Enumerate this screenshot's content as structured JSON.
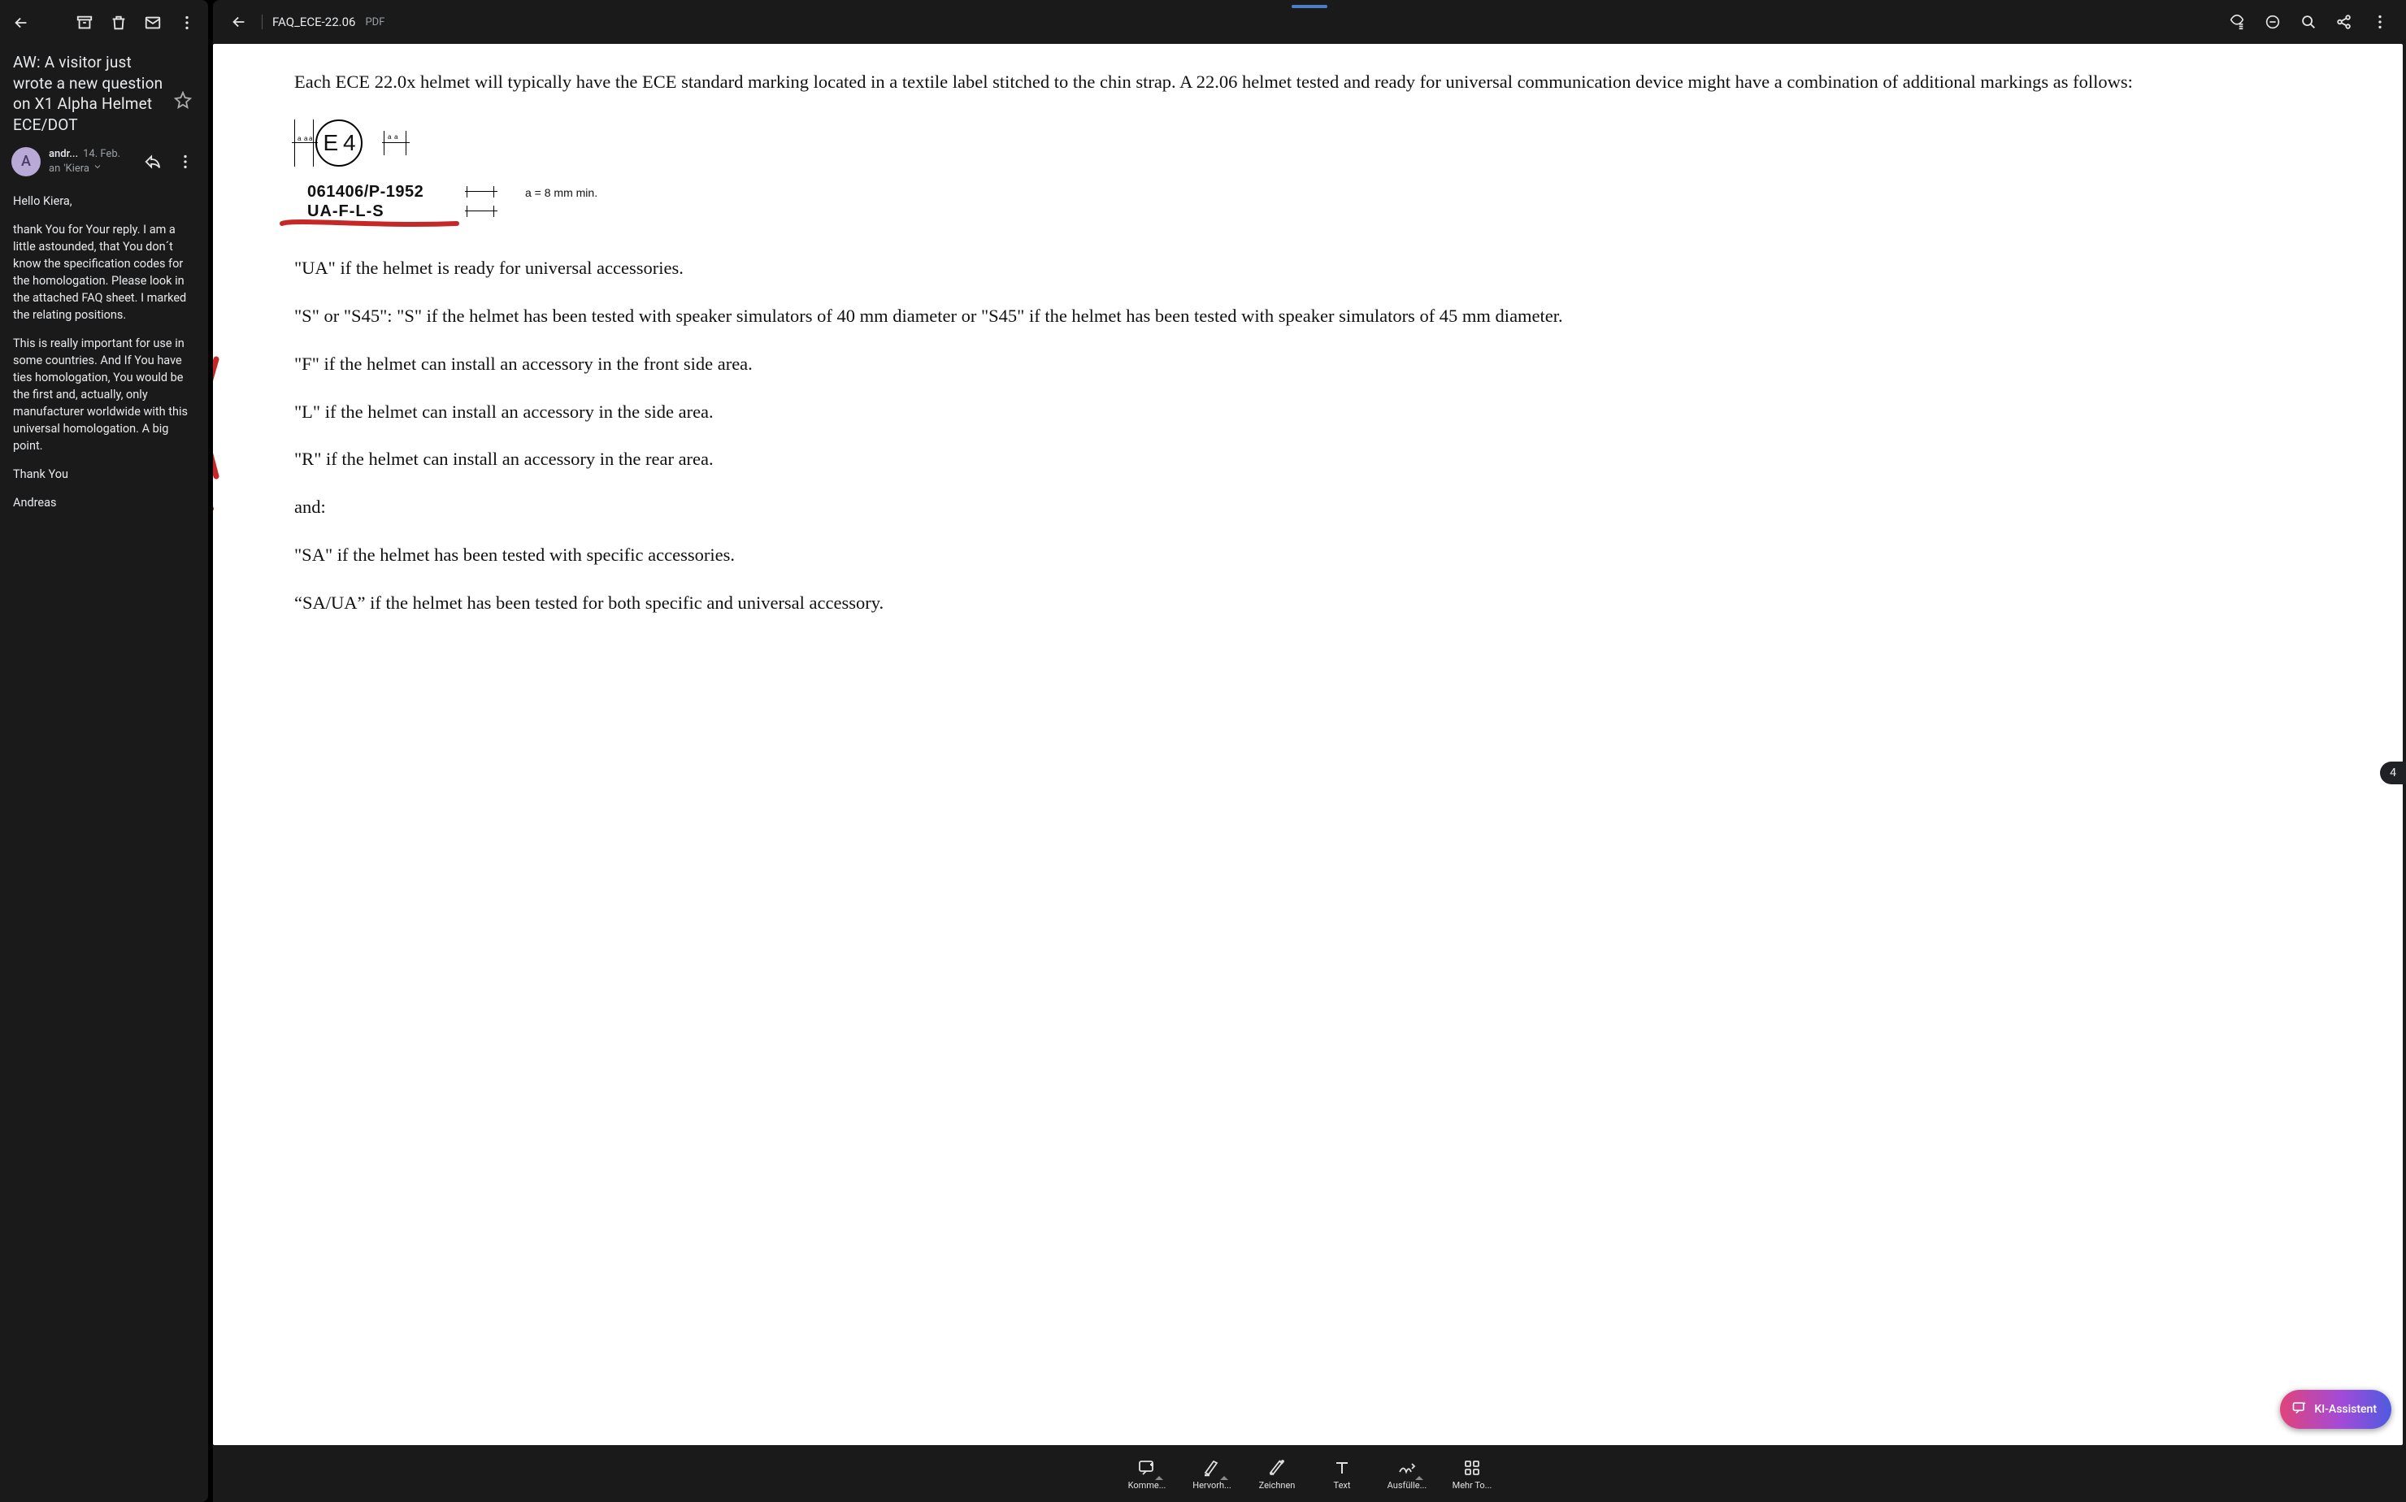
{
  "email": {
    "subject": "AW: A visitor just wrote a new question on X1 Alpha Helmet ECE/DOT",
    "sender_initial": "A",
    "sender_name": "andr...",
    "sender_date": "14. Feb.",
    "to_prefix": "an",
    "to_name": "'Kiera",
    "body": {
      "p1": "Hello Kiera,",
      "p2": "thank You for Your reply. I am a little astounded, that You don´t know the specification codes for the homologation. Please look in the attached FAQ sheet. I marked the relating positions.",
      "p3": "This is really important for use in some countries. And If You have ties homologation, You would be the first and, actually, only manufacturer worldwide with this universal homologation. A big point.",
      "p4": "Thank You",
      "p5": "Andreas"
    }
  },
  "doc": {
    "title": "FAQ_ECE-22.06",
    "ext": "PDF",
    "page_counter": "4",
    "content": {
      "intro": "Each ECE 22.0x helmet will typically have the ECE standard marking located in a textile label stitched to the chin strap. A 22.06 helmet tested and ready for universal communication device might have a combination of additional markings as follows:",
      "emark_text": "E 4",
      "code1": "061406/P-1952",
      "code2": "UA-F-L-S",
      "note_a": "a = 8 mm min.",
      "ua": "\"UA\" if the helmet is ready for universal accessories.",
      "s": "\"S\" or \"S45\": \"S\" if the helmet has been tested with speaker simulators of 40 mm diameter or \"S45\" if the helmet has been tested with speaker simulators of 45 mm diameter.",
      "f": "\"F\" if the helmet can install an accessory in the front side area.",
      "l": "\"L\" if the helmet can install an accessory in the side area.",
      "r": "\"R\" if the helmet can install an accessory in the rear area.",
      "and": "and:",
      "sa": "\"SA\" if the helmet has been tested with specific accessories.",
      "saua": "“SA/UA” if the helmet has been tested for both specific and universal accessory."
    }
  },
  "ai_pill": "KI-Assistent",
  "toolbar": {
    "t1": "Komme...",
    "t2": "Hervorh...",
    "t3": "Zeichnen",
    "t4": "Text",
    "t5": "Ausfülle...",
    "t6": "Mehr To..."
  }
}
